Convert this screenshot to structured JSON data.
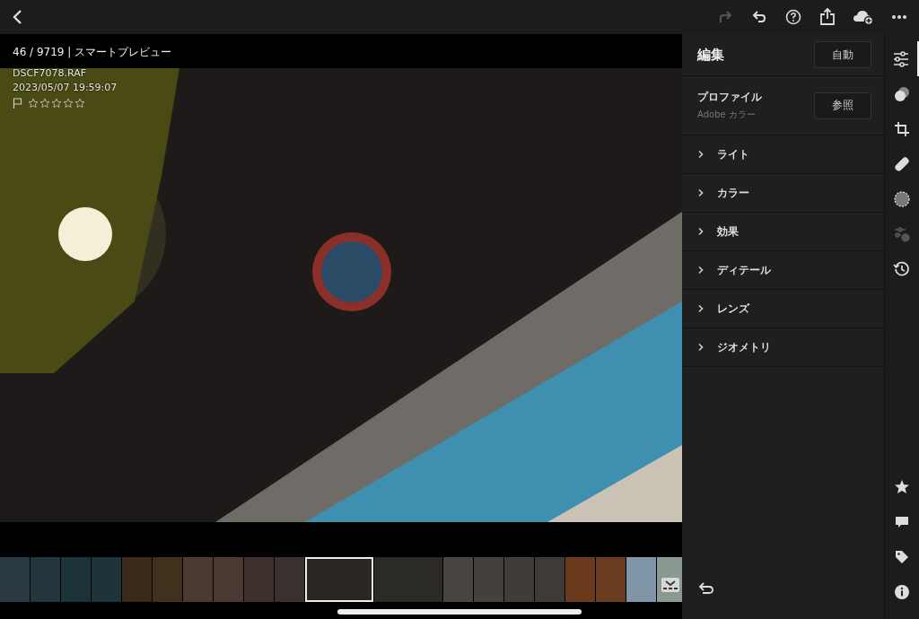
{
  "toolbar": {
    "back": true,
    "actions": [
      {
        "kind": "redo",
        "disabled": true
      },
      {
        "kind": "undo",
        "disabled": false
      },
      {
        "kind": "help",
        "disabled": false
      },
      {
        "kind": "share",
        "disabled": false
      },
      {
        "kind": "cloud",
        "disabled": false
      },
      {
        "kind": "more",
        "disabled": false
      }
    ]
  },
  "photo_info": {
    "position": "46 / 9719 | スマートプレビュー",
    "filename": "DSCF7078.RAF",
    "datetime": "2023/05/07 19:59:07",
    "flagged": false,
    "stars": 0
  },
  "edit_panel": {
    "title": "編集",
    "auto_button": "自動",
    "profile": {
      "label": "プロファイル",
      "value": "Adobe カラー",
      "browse_button": "参照"
    },
    "sections": [
      {
        "label": "ライト",
        "expanded": false
      },
      {
        "label": "カラー",
        "expanded": false
      },
      {
        "label": "効果",
        "expanded": false
      },
      {
        "label": "ディテール",
        "expanded": false
      },
      {
        "label": "レンズ",
        "expanded": false
      },
      {
        "label": "ジオメトリ",
        "expanded": false
      }
    ]
  },
  "tool_rail": [
    {
      "kind": "sliders",
      "selected": true,
      "disabled": false
    },
    {
      "kind": "mix",
      "selected": false,
      "disabled": false
    },
    {
      "kind": "crop",
      "selected": false,
      "disabled": false
    },
    {
      "kind": "heal",
      "selected": false,
      "disabled": false
    },
    {
      "kind": "mask",
      "selected": false,
      "disabled": false
    },
    {
      "kind": "preset",
      "selected": false,
      "disabled": true
    },
    {
      "kind": "history",
      "selected": false,
      "disabled": false
    }
  ],
  "info_rail": [
    {
      "kind": "star"
    },
    {
      "kind": "comment"
    },
    {
      "kind": "tag"
    },
    {
      "kind": "info"
    }
  ],
  "filmstrip": [
    {
      "kind": "portrait",
      "color": "#2a3a40",
      "selected": false
    },
    {
      "kind": "portrait",
      "color": "#23363b",
      "selected": false
    },
    {
      "kind": "portrait",
      "color": "#1c3338",
      "selected": false
    },
    {
      "kind": "portrait",
      "color": "#1f3438",
      "selected": false
    },
    {
      "kind": "portrait",
      "color": "#3a2a1a",
      "selected": false
    },
    {
      "kind": "portrait",
      "color": "#40301c",
      "selected": false
    },
    {
      "kind": "portrait",
      "color": "#4a3a32",
      "selected": false
    },
    {
      "kind": "portrait",
      "color": "#4a3a33",
      "selected": false
    },
    {
      "kind": "portrait",
      "color": "#3e302c",
      "selected": false
    },
    {
      "kind": "portrait",
      "color": "#3a3030",
      "selected": false
    },
    {
      "kind": "landscape",
      "color": "#2a2624",
      "selected": true
    },
    {
      "kind": "landscape",
      "color": "#2c2a26",
      "selected": false
    },
    {
      "kind": "portrait",
      "color": "#4a4440",
      "selected": false
    },
    {
      "kind": "portrait",
      "color": "#45403c",
      "selected": false
    },
    {
      "kind": "portrait",
      "color": "#423c38",
      "selected": false
    },
    {
      "kind": "portrait",
      "color": "#403a36",
      "selected": false
    },
    {
      "kind": "portrait",
      "color": "#6a3a1c",
      "selected": false
    },
    {
      "kind": "portrait",
      "color": "#6a3c20",
      "selected": false
    },
    {
      "kind": "portrait",
      "color": "#7f96a8",
      "selected": false
    },
    {
      "kind": "portrait",
      "color": "#8a9a90",
      "selected": false
    }
  ]
}
